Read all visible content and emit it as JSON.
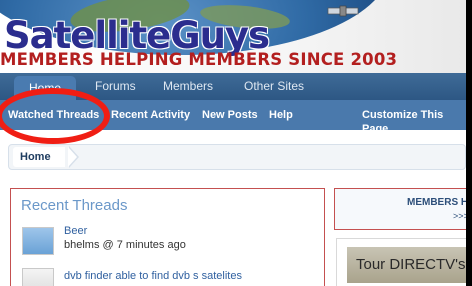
{
  "banner": {
    "logo_text": "SatelliteGuys",
    "tagline": "MEMBERS HELPING MEMBERS SINCE 2003"
  },
  "main_nav": {
    "home": "Home",
    "forums": "Forums",
    "members": "Members",
    "other_sites": "Other Sites"
  },
  "sub_nav": {
    "watched_threads": "Watched Threads",
    "recent_activity": "Recent Activity",
    "new_posts": "New Posts",
    "help": "Help",
    "customize": "Customize This Page"
  },
  "breadcrumb": {
    "home": "Home"
  },
  "recent_threads": {
    "title": "Recent Threads",
    "items": [
      {
        "title": "Beer",
        "meta": "bhelms @ 7 minutes ago"
      },
      {
        "title": "dvb finder able to find dvb s satelites",
        "meta": ""
      }
    ]
  },
  "right_column": {
    "members_box_title": "MEMBERS HE",
    "members_box_more": ">>>",
    "ad_text": "Tour DIRECTV's"
  },
  "colors": {
    "highlight": "#f01e14",
    "nav": "#2d5784",
    "subnav": "#4a79ac"
  }
}
